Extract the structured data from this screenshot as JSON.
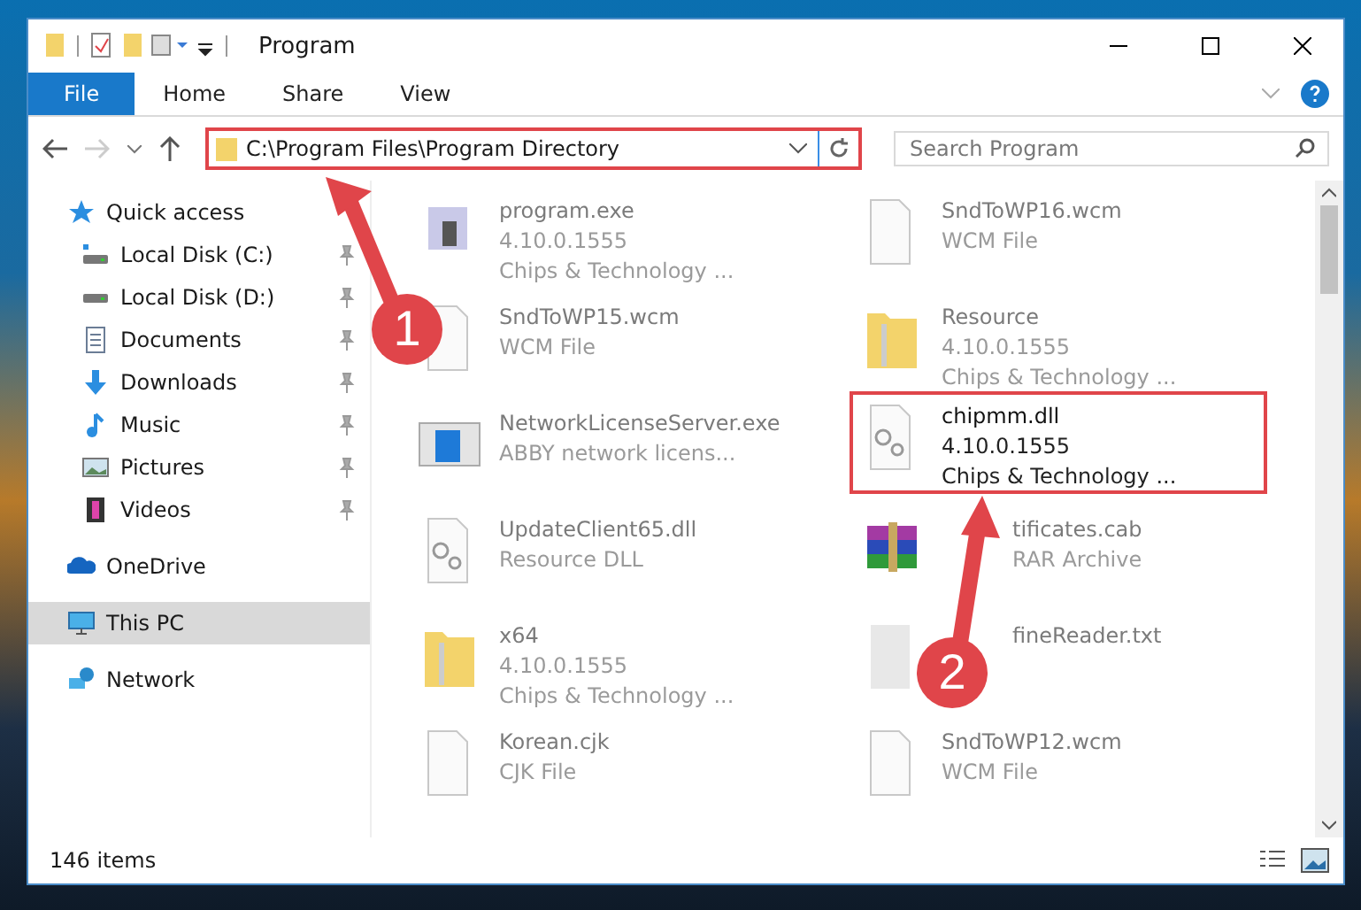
{
  "window": {
    "title": "Program"
  },
  "ribbon_tabs": [
    {
      "label": "File",
      "selected": true
    },
    {
      "label": "Home",
      "selected": false
    },
    {
      "label": "Share",
      "selected": false
    },
    {
      "label": "View",
      "selected": false
    }
  ],
  "address_bar": {
    "path": "C:\\Program Files\\Program Directory"
  },
  "search": {
    "placeholder": "Search Program"
  },
  "sidebar": {
    "items": [
      {
        "label": "Quick access",
        "kind": "star",
        "selected": false,
        "children": [
          {
            "label": "Local Disk (C:)",
            "kind": "systemdisk",
            "pinned": true,
            "selected": false
          },
          {
            "label": "Local Disk (D:)",
            "kind": "disk",
            "pinned": true,
            "selected": false
          },
          {
            "label": "Documents",
            "kind": "documents",
            "pinned": true,
            "selected": false
          },
          {
            "label": "Downloads",
            "kind": "downloads",
            "pinned": true,
            "selected": false
          },
          {
            "label": "Music",
            "kind": "music",
            "pinned": true,
            "selected": false
          },
          {
            "label": "Pictures",
            "kind": "pictures",
            "pinned": true,
            "selected": false
          },
          {
            "label": "Videos",
            "kind": "videos",
            "pinned": true,
            "selected": false
          }
        ]
      },
      {
        "label": "OneDrive",
        "kind": "cloud",
        "selected": false
      },
      {
        "label": "This PC",
        "kind": "pc",
        "selected": true
      },
      {
        "label": "Network",
        "kind": "network",
        "selected": false
      }
    ]
  },
  "files": [
    {
      "kind": "exe",
      "name": "program.exe",
      "lines": [
        "4.10.0.1555",
        "Chips & Technology ..."
      ],
      "highlighted": false
    },
    {
      "kind": "doc",
      "name": "SndToWP16.wcm",
      "lines": [
        "WCM File"
      ],
      "highlighted": false
    },
    {
      "kind": "doc",
      "name": "SndToWP15.wcm",
      "lines": [
        "WCM File"
      ],
      "highlighted": false
    },
    {
      "kind": "folder",
      "name": "Resource",
      "lines": [
        "4.10.0.1555",
        "Chips & Technology ..."
      ],
      "highlighted": false
    },
    {
      "kind": "app",
      "name": "NetworkLicenseServer.exe",
      "lines": [
        "ABBY network licens..."
      ],
      "highlighted": false
    },
    {
      "kind": "dll",
      "name": "chipmm.dll",
      "lines": [
        "4.10.0.1555",
        "Chips & Technology ..."
      ],
      "highlighted": true
    },
    {
      "kind": "dll",
      "name": "UpdateClient65.dll",
      "lines": [
        "Resource DLL"
      ],
      "highlighted": false
    },
    {
      "kind": "archive",
      "name": "tificates.cab",
      "lines": [
        "RAR Archive"
      ],
      "highlighted": false,
      "covered": true
    },
    {
      "kind": "folder",
      "name": "x64",
      "lines": [
        "4.10.0.1555",
        "Chips & Technology ..."
      ],
      "highlighted": false
    },
    {
      "kind": "blank",
      "name": "fineReader.txt",
      "highlighted": false,
      "covered": true
    },
    {
      "kind": "doc",
      "name": "Korean.cjk",
      "lines": [
        "CJK File"
      ],
      "highlighted": false
    },
    {
      "kind": "doc",
      "name": "SndToWP12.wcm",
      "lines": [
        "WCM File"
      ],
      "highlighted": false
    }
  ],
  "status_bar": {
    "item_count": "146 items"
  },
  "annotations": [
    {
      "number": "1"
    },
    {
      "number": "2"
    }
  ]
}
